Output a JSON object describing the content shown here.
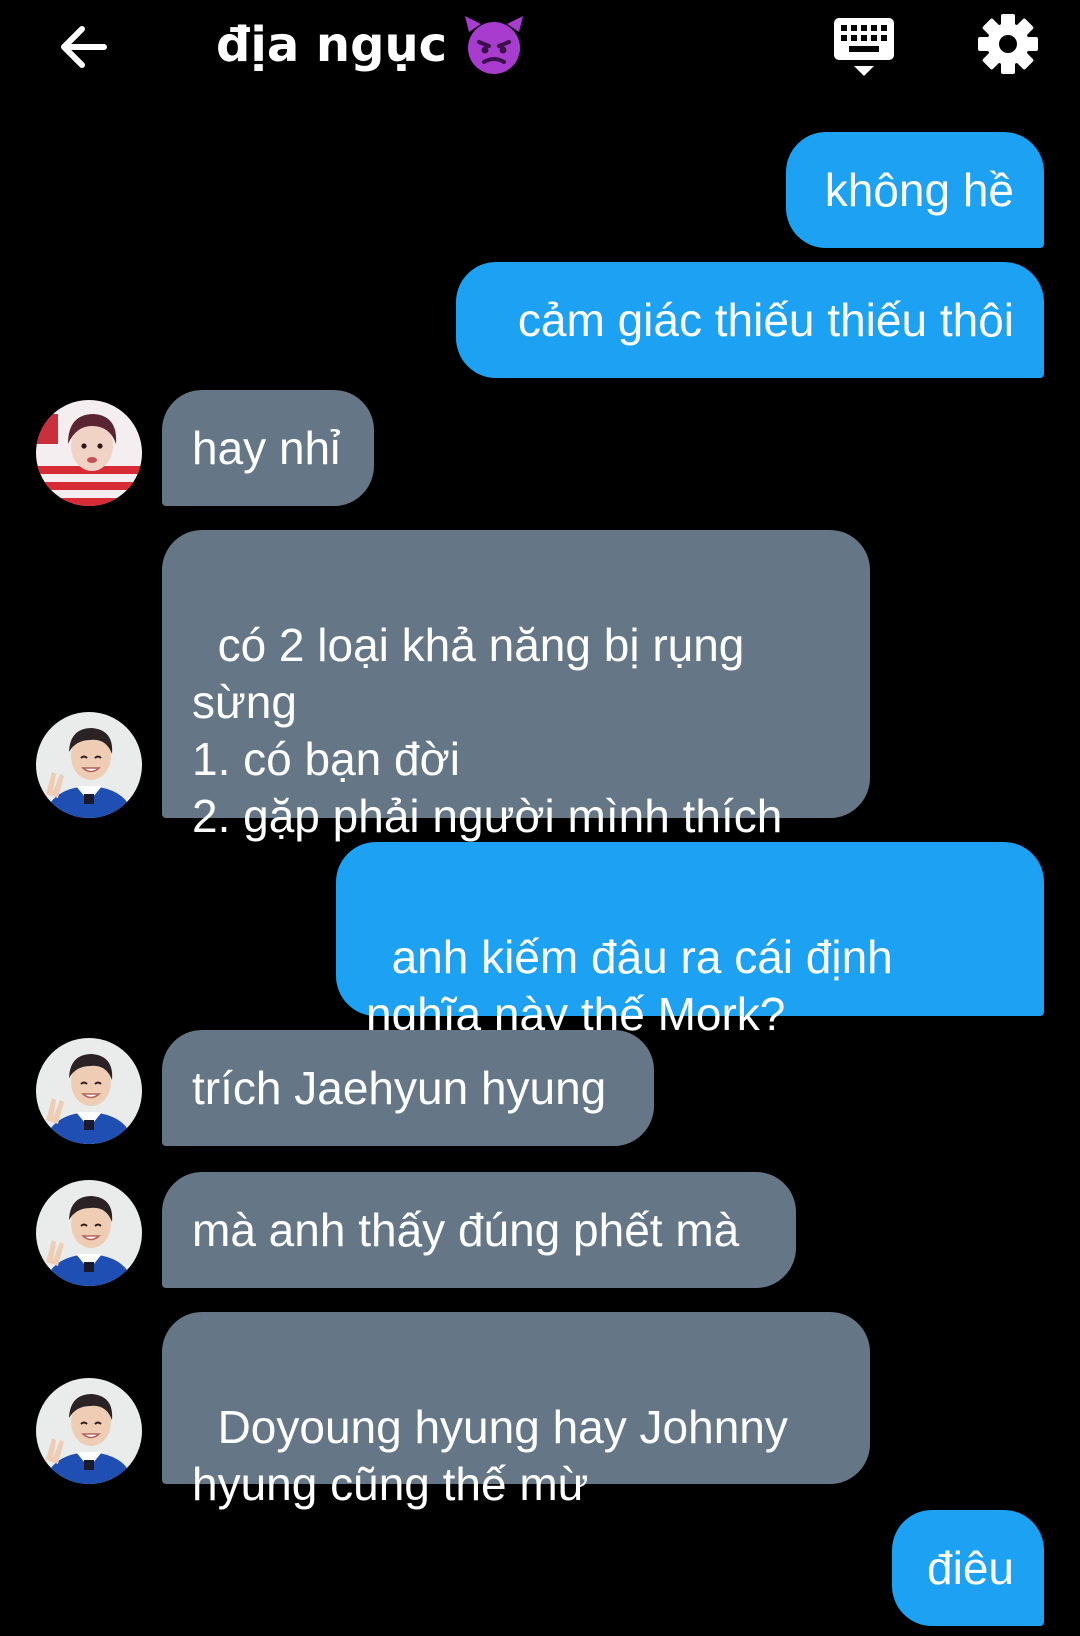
{
  "header": {
    "title": "địa ngục",
    "icons": {
      "back": "arrow-left-icon",
      "emoji": "angry-devil-emoji",
      "keyboard": "keyboard-icon",
      "settings": "gear-icon"
    }
  },
  "colors": {
    "background": "#000000",
    "outgoing_bubble": "#1da1f2",
    "incoming_bubble": "#657786",
    "text": "#ffffff"
  },
  "messages": [
    {
      "sender": "me",
      "text": "không hề"
    },
    {
      "sender": "me",
      "text": "cảm giác thiếu thiếu thôi"
    },
    {
      "sender": "other",
      "avatar": "avatar-red-stripe",
      "text": "hay nhỉ"
    },
    {
      "sender": "other",
      "avatar": "avatar-blue-shirt",
      "text": "có 2 loại khả năng bị rụng\nsừng\n1. có bạn đời\n2. gặp phải người mình thích"
    },
    {
      "sender": "me",
      "text": "anh kiếm đâu ra cái định\nnghĩa này thế Mork?"
    },
    {
      "sender": "other",
      "avatar": "avatar-blue-shirt",
      "text": "trích Jaehyun hyung"
    },
    {
      "sender": "other",
      "avatar": "avatar-blue-shirt",
      "text": "mà anh thấy đúng phết mà"
    },
    {
      "sender": "other",
      "avatar": "avatar-blue-shirt",
      "text": "Doyoung hyung hay Johnny\nhyung cũng thế mừ"
    },
    {
      "sender": "me",
      "text": "điêu"
    }
  ]
}
